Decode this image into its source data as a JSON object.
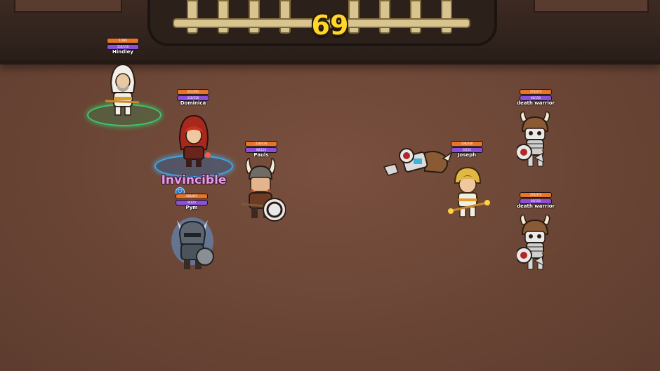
{
  "timer": "69",
  "status_text": "Invincible",
  "colors": {
    "hp": "#e8742a",
    "mp": "#8c4fd9",
    "timer": "#ffd62a",
    "status": "#e89be6"
  },
  "units": [
    {
      "id": "hindley",
      "name": "Hindley",
      "hp_text": "1/380",
      "mp_text": "150/150",
      "team": "ally",
      "circle": "green-rune-circle"
    },
    {
      "id": "dominica",
      "name": "Dominica",
      "hp_text": "241/281",
      "mp_text": "150/150",
      "team": "ally",
      "circle": "blue-rune-circle"
    },
    {
      "id": "pauls",
      "name": "Pauls",
      "hp_text": "256/330",
      "mp_text": "88/150",
      "team": "ally"
    },
    {
      "id": "pym",
      "name": "Pym",
      "hp_text": "166/427",
      "mp_text": "8/120",
      "team": "ally",
      "buff": "shield-icon"
    },
    {
      "id": "joseph",
      "name": "Joseph",
      "hp_text": "106/240",
      "mp_text": "8/150",
      "team": "ally"
    },
    {
      "id": "death-warrior-1",
      "name": "death warrior",
      "hp_text": "374/374",
      "mp_text": "60/150",
      "team": "enemy"
    },
    {
      "id": "death-warrior-2",
      "name": "death warrior",
      "hp_text": "374/374",
      "mp_text": "60/150",
      "team": "enemy"
    }
  ]
}
